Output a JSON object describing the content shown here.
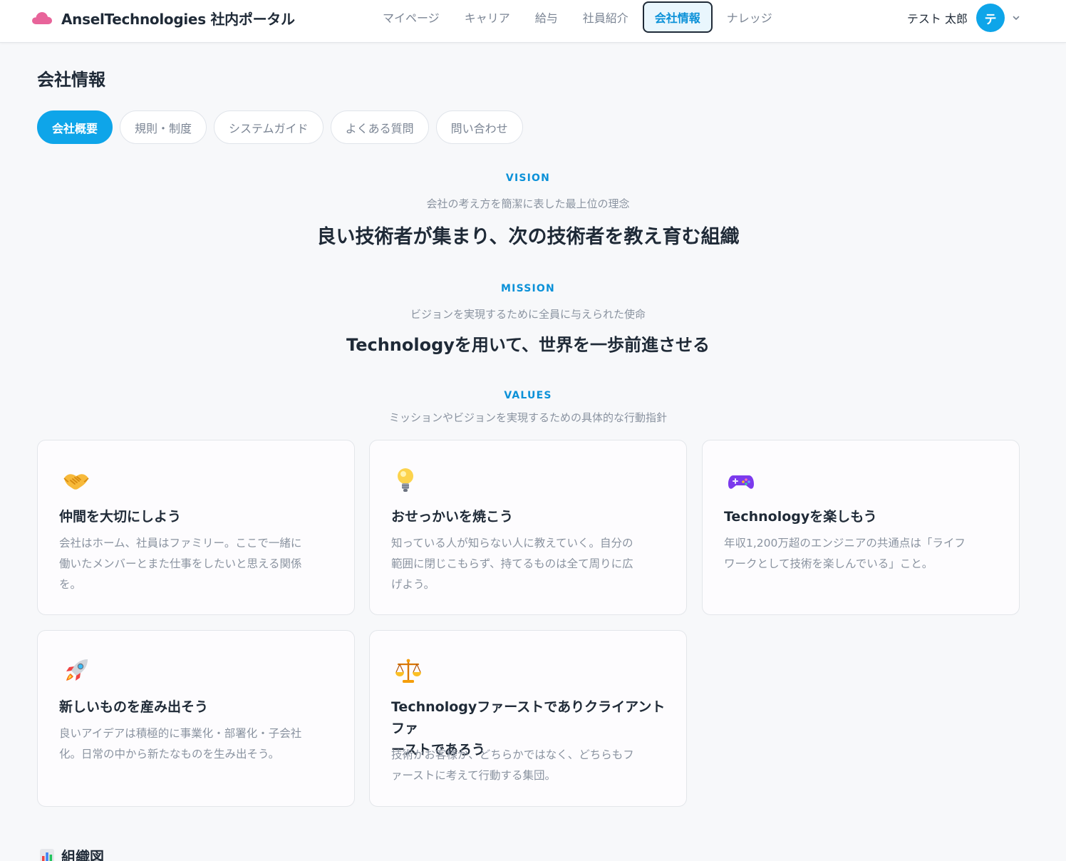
{
  "header": {
    "brand_name": "AnselTechnologies 社内ポータル",
    "brand_logo_icon": "cloud-icon",
    "brand_color": "#e8649a",
    "nav": [
      {
        "label": "マイページ",
        "active": false
      },
      {
        "label": "キャリア",
        "active": false
      },
      {
        "label": "給与",
        "active": false
      },
      {
        "label": "社員紹介",
        "active": false
      },
      {
        "label": "会社情報",
        "active": true
      },
      {
        "label": "ナレッジ",
        "active": false
      }
    ],
    "user": {
      "name": "テスト 太郎",
      "avatar_initial": "テ",
      "menu_icon": "chevron-down-icon"
    }
  },
  "page": {
    "title": "会社情報",
    "tabs": [
      {
        "label": "会社概要",
        "active": true
      },
      {
        "label": "規則・制度",
        "active": false
      },
      {
        "label": "システムガイド",
        "active": false
      },
      {
        "label": "よくある質問",
        "active": false
      },
      {
        "label": "問い合わせ",
        "active": false
      }
    ]
  },
  "vision": {
    "label": "VISION",
    "description": "会社の考え方を簡潔に表した最上位の理念",
    "statement": "良い技術者が集まり、次の技術者を教え育む組織"
  },
  "mission": {
    "label": "MISSION",
    "description": "ビジョンを実現するために全員に与えられた使命",
    "statement": "Technologyを用いて、世界を一歩前進させる"
  },
  "values": {
    "label": "VALUES",
    "description": "ミッションやビジョンを実現するための具体的な行動指針",
    "items": [
      {
        "icon": "handshake-icon",
        "title": "仲間を大切にしよう",
        "body": [
          "会社はホーム、社員はファミリー。ここで一緒に",
          "働いたメンバーとまた仕事をしたいと思える関係",
          "を。"
        ]
      },
      {
        "icon": "lightbulb-icon",
        "title": "おせっかいを焼こう",
        "body": [
          "知っている人が知らない人に教えていく。自分の",
          "範囲に閉じこもらず、持てるものは全て周りに広",
          "げよう。"
        ]
      },
      {
        "icon": "game-controller-icon",
        "title": "Technologyを楽しもう",
        "body": [
          "年収1,200万超のエンジニアの共通点は「ライフ",
          "ワークとして技術を楽しんでいる」こと。"
        ]
      },
      {
        "icon": "rocket-icon",
        "title": "新しいものを産み出そう",
        "body": [
          "良いアイデアは積極的に事業化・部署化・子会社",
          "化。日常の中から新たなものを生み出そう。"
        ]
      },
      {
        "icon": "balance-scale-icon",
        "title": [
          "Technologyファーストでありクライアントファ",
          "ーストであろう"
        ],
        "body": [
          "技術かお客様か、どちらかではなく、どちらもフ",
          "ァーストに考えて行動する集団。"
        ]
      }
    ]
  },
  "org_chart": {
    "icon": "bar-chart-icon",
    "title": "組織図"
  },
  "colors": {
    "accent": "#0ea5e9",
    "accent_text": "#0b91d8",
    "text": "#1f2a37",
    "muted": "#8a93a0"
  }
}
